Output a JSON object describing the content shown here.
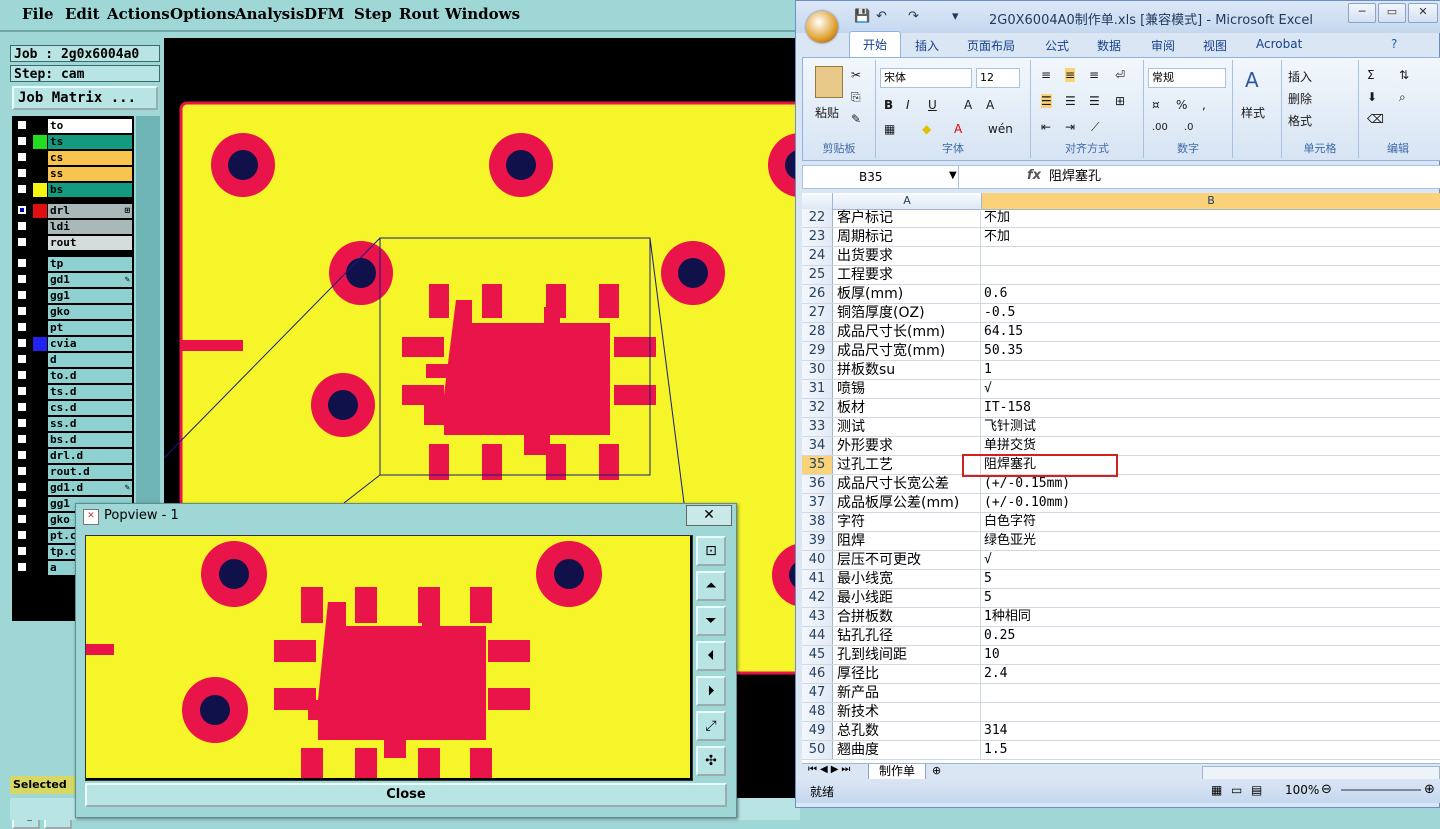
{
  "cam": {
    "menu": [
      "File",
      "Edit",
      "Actions",
      "Options",
      "Analysis",
      "DFM",
      "Step",
      "Rout",
      "Windows"
    ],
    "job": "Job : 2g0x6004a0",
    "step": "Step: cam",
    "job_matrix": "Job Matrix ...",
    "selected_label": "Selected",
    "layers": [
      {
        "name": "to",
        "color": "#000000",
        "bg": "#ffffff",
        "active": false,
        "mark": ""
      },
      {
        "name": "ts",
        "color": "#22dd22",
        "bg": "#149a7e",
        "active": false,
        "mark": ""
      },
      {
        "name": "cs",
        "color": "#000000",
        "bg": "#f7c44e",
        "active": false,
        "mark": ""
      },
      {
        "name": "ss",
        "color": "#000000",
        "bg": "#f7c44e",
        "active": false,
        "mark": ""
      },
      {
        "name": "bs",
        "color": "#f5f514",
        "bg": "#149a7e",
        "active": false,
        "mark": ""
      },
      {
        "name": "drl",
        "color": "#e01010",
        "bg": "#a9b9b9",
        "active": true,
        "mark": "⊞"
      },
      {
        "name": "ldi",
        "color": "#000000",
        "bg": "#a9b9b9",
        "active": false,
        "mark": ""
      },
      {
        "name": "rout",
        "color": "#000000",
        "bg": "#d4dcdc",
        "active": false,
        "mark": ""
      },
      {
        "name": "tp",
        "color": "#000000",
        "bg": "#8fd0d0",
        "active": false,
        "mark": ""
      },
      {
        "name": "gd1",
        "color": "#000000",
        "bg": "#8fd0d0",
        "active": false,
        "mark": "✎"
      },
      {
        "name": "gg1",
        "color": "#000000",
        "bg": "#8fd0d0",
        "active": false,
        "mark": ""
      },
      {
        "name": "gko",
        "color": "#000000",
        "bg": "#8fd0d0",
        "active": false,
        "mark": ""
      },
      {
        "name": "pt",
        "color": "#000000",
        "bg": "#8fd0d0",
        "active": false,
        "mark": ""
      },
      {
        "name": "cvia",
        "color": "#2222ee",
        "bg": "#8fd0d0",
        "active": false,
        "mark": ""
      },
      {
        "name": "d",
        "color": "#000000",
        "bg": "#8fd0d0",
        "active": false,
        "mark": ""
      },
      {
        "name": "to.d",
        "color": "#000000",
        "bg": "#8fd0d0",
        "active": false,
        "mark": ""
      },
      {
        "name": "ts.d",
        "color": "#000000",
        "bg": "#8fd0d0",
        "active": false,
        "mark": ""
      },
      {
        "name": "cs.d",
        "color": "#000000",
        "bg": "#8fd0d0",
        "active": false,
        "mark": ""
      },
      {
        "name": "ss.d",
        "color": "#000000",
        "bg": "#8fd0d0",
        "active": false,
        "mark": ""
      },
      {
        "name": "bs.d",
        "color": "#000000",
        "bg": "#8fd0d0",
        "active": false,
        "mark": ""
      },
      {
        "name": "drl.d",
        "color": "#000000",
        "bg": "#8fd0d0",
        "active": false,
        "mark": ""
      },
      {
        "name": "rout.d",
        "color": "#000000",
        "bg": "#8fd0d0",
        "active": false,
        "mark": ""
      },
      {
        "name": "gd1.d",
        "color": "#000000",
        "bg": "#8fd0d0",
        "active": false,
        "mark": "✎"
      },
      {
        "name": "gg1",
        "color": "#000000",
        "bg": "#8fd0d0",
        "active": false,
        "mark": ""
      },
      {
        "name": "gko",
        "color": "#000000",
        "bg": "#8fd0d0",
        "active": false,
        "mark": ""
      },
      {
        "name": "pt.c",
        "color": "#000000",
        "bg": "#8fd0d0",
        "active": false,
        "mark": ""
      },
      {
        "name": "tp.c",
        "color": "#000000",
        "bg": "#8fd0d0",
        "active": false,
        "mark": ""
      },
      {
        "name": "a",
        "color": "#000000",
        "bg": "#8fd0d0",
        "active": false,
        "mark": ""
      }
    ],
    "colors": {
      "board": "#f5f52a",
      "copper": "#e8144a",
      "hole": "#10104a",
      "canvas": "#000000"
    }
  },
  "popview": {
    "title": "Popview - 1",
    "close_x": "✕",
    "close_label": "Close"
  },
  "excel": {
    "title": "2G0X6004A0制作单.xls  [兼容模式] - Microsoft Excel",
    "ribbon_tabs": [
      "开始",
      "插入",
      "页面布局",
      "公式",
      "数据",
      "审阅",
      "视图",
      "Acrobat"
    ],
    "font_name": "宋体",
    "font_size": "12",
    "number_format": "常规",
    "groups": [
      "剪贴板",
      "字体",
      "对齐方式",
      "数字",
      "单元格",
      "编辑"
    ],
    "paste_label": "粘贴",
    "style_label": "样式",
    "insert_label": "插入",
    "delete_label": "删除",
    "format_label": "格式",
    "name_box": "B35",
    "fx": "fx",
    "formula_value": "阻焊塞孔",
    "columns": [
      "A",
      "B"
    ],
    "rows": [
      {
        "n": "22",
        "a": "客户标记",
        "b": "不加"
      },
      {
        "n": "23",
        "a": "周期标记",
        "b": "不加"
      },
      {
        "n": "24",
        "a": "出货要求",
        "b": ""
      },
      {
        "n": "25",
        "a": "工程要求",
        "b": ""
      },
      {
        "n": "26",
        "a": "板厚(mm)",
        "b": "0.6"
      },
      {
        "n": "27",
        "a": "铜箔厚度(OZ)",
        "b": "-0.5"
      },
      {
        "n": "28",
        "a": "成品尺寸长(mm)",
        "b": "64.15"
      },
      {
        "n": "29",
        "a": "成品尺寸宽(mm)",
        "b": "50.35"
      },
      {
        "n": "30",
        "a": "拼板数su",
        "b": "1"
      },
      {
        "n": "31",
        "a": "喷锡",
        "b": "√"
      },
      {
        "n": "32",
        "a": "板材",
        "b": "IT-158"
      },
      {
        "n": "33",
        "a": "测试",
        "b": "飞针测试"
      },
      {
        "n": "34",
        "a": "外形要求",
        "b": "单拼交货"
      },
      {
        "n": "35",
        "a": "过孔工艺",
        "b": "阻焊塞孔"
      },
      {
        "n": "36",
        "a": "成品尺寸长宽公差",
        "b": "(+/-0.15mm)"
      },
      {
        "n": "37",
        "a": "成品板厚公差(mm)",
        "b": "(+/-0.10mm)"
      },
      {
        "n": "38",
        "a": "字符",
        "b": "白色字符"
      },
      {
        "n": "39",
        "a": "阻焊",
        "b": "绿色亚光"
      },
      {
        "n": "40",
        "a": "层压不可更改",
        "b": "√"
      },
      {
        "n": "41",
        "a": "最小线宽",
        "b": "5"
      },
      {
        "n": "42",
        "a": "最小线距",
        "b": "5"
      },
      {
        "n": "43",
        "a": "合拼板数",
        "b": "1种相同"
      },
      {
        "n": "44",
        "a": "钻孔孔径",
        "b": "0.25"
      },
      {
        "n": "45",
        "a": "孔到线间距",
        "b": "10"
      },
      {
        "n": "46",
        "a": "厚径比",
        "b": "2.4"
      },
      {
        "n": "47",
        "a": "新产品",
        "b": ""
      },
      {
        "n": "48",
        "a": "新技术",
        "b": ""
      },
      {
        "n": "49",
        "a": "总孔数",
        "b": "314"
      },
      {
        "n": "50",
        "a": "翘曲度",
        "b": "1.5"
      }
    ],
    "sheet_tab": "制作单",
    "status_ready": "就绪",
    "zoom": "100%"
  }
}
